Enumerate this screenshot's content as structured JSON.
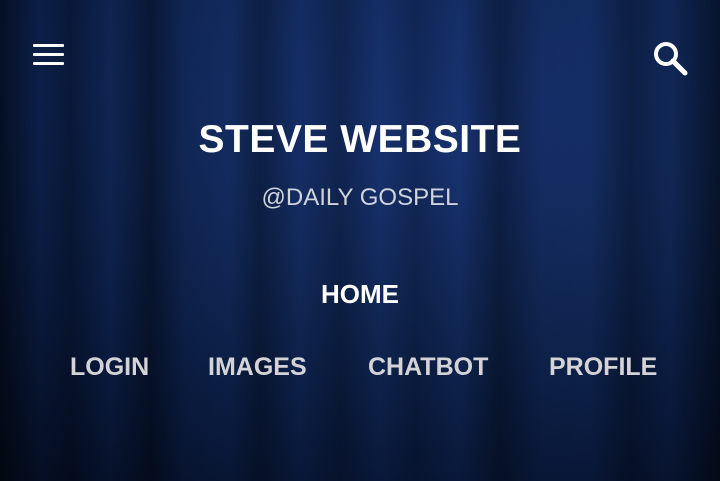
{
  "header": {
    "menu_icon": "hamburger-menu-icon",
    "search_icon": "search-icon"
  },
  "site": {
    "title": "STEVE WEBSITE",
    "subtitle": "@DAILY GOSPEL"
  },
  "nav": {
    "home": "HOME",
    "items": [
      {
        "label": "LOGIN"
      },
      {
        "label": "IMAGES"
      },
      {
        "label": "CHATBOT"
      },
      {
        "label": "PROFILE"
      }
    ]
  },
  "colors": {
    "background": "#16336f",
    "text_primary": "#ffffff",
    "text_secondary": "#cfd3dc"
  }
}
